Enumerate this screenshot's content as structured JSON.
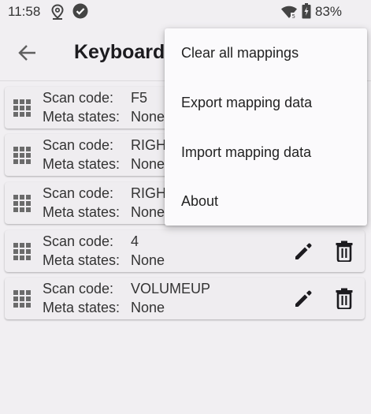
{
  "status_bar": {
    "time": "11:58",
    "battery": "83%",
    "icons": [
      "location-icon",
      "check-circle-icon",
      "wifi-icon",
      "battery-icon"
    ]
  },
  "app_bar": {
    "title": "Keyboard",
    "back_icon": "arrow-back-icon"
  },
  "mappings": [
    {
      "scan_code_label": "Scan code:",
      "scan_code": "F5",
      "meta_label": "Meta states:",
      "meta": "None"
    },
    {
      "scan_code_label": "Scan code:",
      "scan_code": "RIGH",
      "meta_label": "Meta states:",
      "meta": "None"
    },
    {
      "scan_code_label": "Scan code:",
      "scan_code": "RIGH",
      "meta_label": "Meta states:",
      "meta": "None"
    },
    {
      "scan_code_label": "Scan code:",
      "scan_code": "4",
      "meta_label": "Meta states:",
      "meta": "None"
    },
    {
      "scan_code_label": "Scan code:",
      "scan_code": "VOLUMEUP",
      "meta_label": "Meta states:",
      "meta": "None"
    }
  ],
  "menu": {
    "items": [
      "Clear all mappings",
      "Export mapping data",
      "Import mapping data",
      "About"
    ]
  },
  "colors": {
    "background": "#f1eff2",
    "card": "#efedf0",
    "menu": "#fbfafc",
    "icon": "#1c1b1f"
  }
}
